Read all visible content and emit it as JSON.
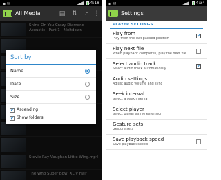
{
  "left": {
    "status": {
      "time": "14:18"
    },
    "title": "All Media",
    "media": [
      {
        "title": "Shine On You Crazy Diamond - Acoustic - Part 1 - Meltdown"
      },
      {
        "title": ""
      },
      {
        "title": ""
      },
      {
        "title": ""
      },
      {
        "title": ""
      },
      {
        "title": ""
      },
      {
        "title": ""
      },
      {
        "title": ""
      },
      {
        "title": "Stevie Ray Vaughan Little Wing.mp4"
      },
      {
        "title": "The Who Super Bowl XLIV Half"
      }
    ],
    "dialog": {
      "title": "Sort by",
      "options": [
        "Name",
        "Date",
        "Size"
      ],
      "checks": [
        "Ascending",
        "Show folders"
      ]
    }
  },
  "right": {
    "status": {
      "time": "14:34"
    },
    "title": "Settings",
    "section": "PLAYER SETTINGS",
    "prefs": [
      {
        "title": "Play from",
        "summary": "Play from the last paused position",
        "check": "on"
      },
      {
        "title": "Play next file",
        "summary": "When playback completes, play the next file",
        "check": "off"
      },
      {
        "title": "Select audio track",
        "summary": "Select audio track automatically",
        "check": "on"
      },
      {
        "title": "Audio settings",
        "summary": "Adjust audio volume and sync",
        "check": "none"
      },
      {
        "title": "Seek interval",
        "summary": "Select a seek interval",
        "check": "none"
      },
      {
        "title": "Select player",
        "summary": "Select player as file extension",
        "check": "none"
      },
      {
        "title": "Gesture sets",
        "summary": "Gesture sets",
        "check": "none"
      },
      {
        "title": "Save playback speed",
        "summary": "Save playback speed",
        "check": "off"
      }
    ]
  }
}
